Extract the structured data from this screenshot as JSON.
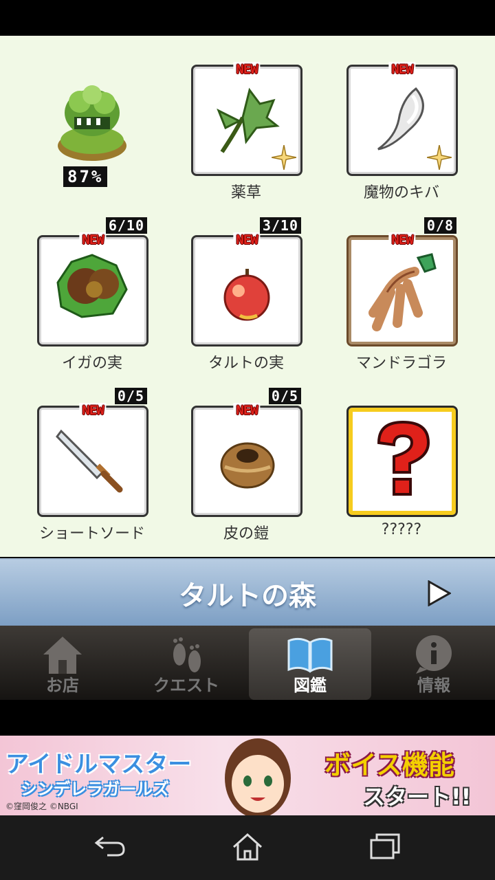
{
  "items": [
    {
      "label": "",
      "badge": "",
      "count": "",
      "percent": "87%"
    },
    {
      "label": "薬草",
      "badge": "NEW",
      "count": ""
    },
    {
      "label": "魔物のキバ",
      "badge": "NEW",
      "count": ""
    },
    {
      "label": "イガの実",
      "badge": "NEW",
      "count": "6/10"
    },
    {
      "label": "タルトの実",
      "badge": "NEW",
      "count": "3/10"
    },
    {
      "label": "マンドラゴラ",
      "badge": "NEW",
      "count": "0/8"
    },
    {
      "label": "ショートソード",
      "badge": "NEW",
      "count": "0/5"
    },
    {
      "label": "皮の鎧",
      "badge": "NEW",
      "count": "0/5"
    },
    {
      "label": "?????",
      "badge": "",
      "count": ""
    }
  ],
  "area": {
    "title": "タルトの森"
  },
  "tabs": [
    {
      "label": "お店",
      "icon": "house-icon"
    },
    {
      "label": "クエスト",
      "icon": "footprints-icon"
    },
    {
      "label": "図鑑",
      "icon": "book-icon",
      "active": true
    },
    {
      "label": "情報",
      "icon": "info-icon"
    }
  ],
  "ad": {
    "line1": "アイドルマスター",
    "line2": "シンデレラガールズ",
    "copyright": "©窪岡俊之 ©NBGI",
    "line3": "ボイス機能",
    "line4": "スタート!!"
  },
  "colors": {
    "accent_new": "#e0211a",
    "content_bg": "#f1f9e6",
    "banner": "#7d9fc4"
  }
}
